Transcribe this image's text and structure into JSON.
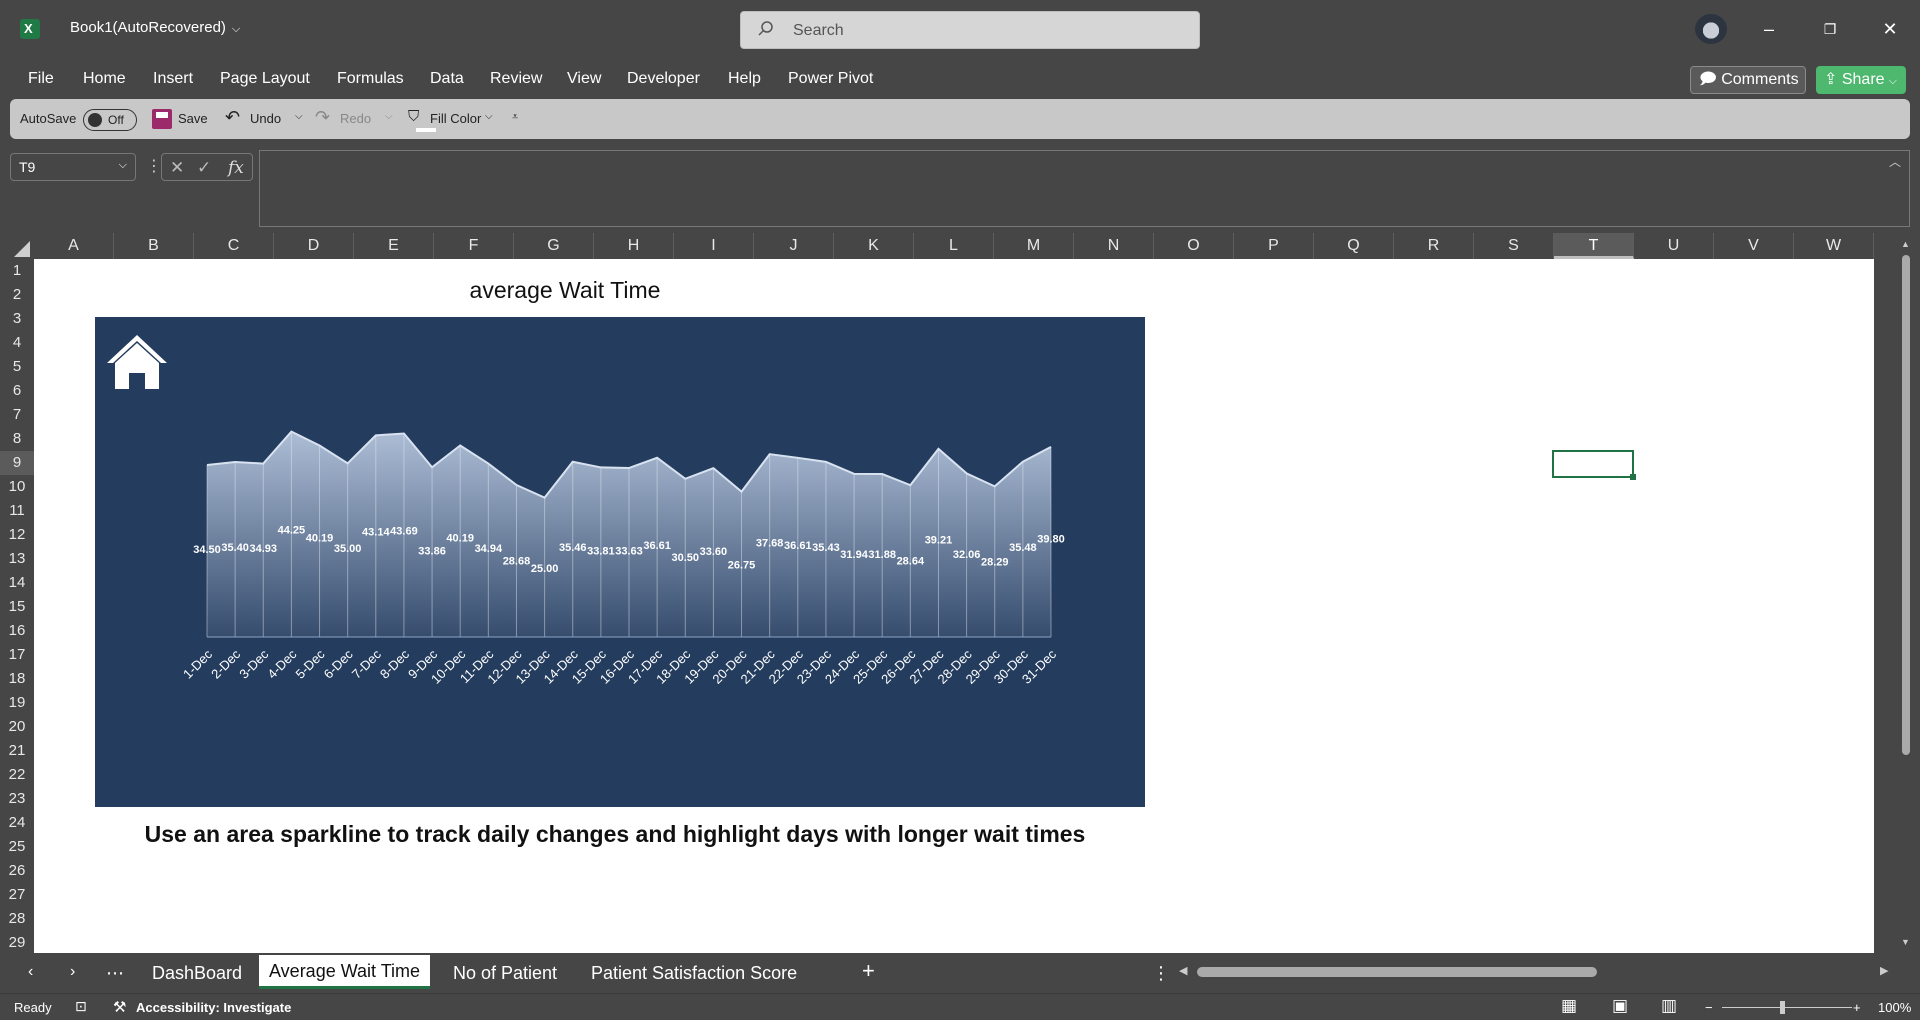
{
  "window": {
    "app_icon_letter": "X",
    "title": "Book1(AutoRecovered)",
    "search_placeholder": "Search"
  },
  "ribbon": {
    "tabs": [
      "File",
      "Home",
      "Insert",
      "Page Layout",
      "Formulas",
      "Data",
      "Review",
      "View",
      "Developer",
      "Help",
      "Power Pivot"
    ],
    "comments_label": "Comments",
    "share_label": "Share"
  },
  "qat": {
    "autosave_label": "AutoSave",
    "autosave_state": "Off",
    "save_label": "Save",
    "undo_label": "Undo",
    "redo_label": "Redo",
    "fill_color_label": "Fill Color"
  },
  "formula_bar": {
    "name_box": "T9",
    "fx_label": "fx"
  },
  "grid": {
    "columns": [
      "A",
      "B",
      "C",
      "D",
      "E",
      "F",
      "G",
      "H",
      "I",
      "J",
      "K",
      "L",
      "M",
      "N",
      "O",
      "P",
      "Q",
      "R",
      "S",
      "T",
      "U",
      "V",
      "W"
    ],
    "rows": [
      "1",
      "2",
      "3",
      "4",
      "5",
      "6",
      "7",
      "8",
      "9",
      "10",
      "11",
      "12",
      "13",
      "14",
      "15",
      "16",
      "17",
      "18",
      "19",
      "20",
      "21",
      "22",
      "23",
      "24",
      "25",
      "26",
      "27",
      "28",
      "29"
    ],
    "selected_column": "T",
    "selected_row": "9"
  },
  "sheet": {
    "title": "average Wait Time",
    "caption": "Use an area sparkline to track daily changes and highlight days with longer wait times"
  },
  "chart_data": {
    "type": "area",
    "title": "average Wait Time",
    "categories": [
      "1-Dec",
      "2-Dec",
      "3-Dec",
      "4-Dec",
      "5-Dec",
      "6-Dec",
      "7-Dec",
      "8-Dec",
      "9-Dec",
      "10-Dec",
      "11-Dec",
      "12-Dec",
      "13-Dec",
      "14-Dec",
      "15-Dec",
      "16-Dec",
      "17-Dec",
      "18-Dec",
      "19-Dec",
      "20-Dec",
      "21-Dec",
      "22-Dec",
      "23-Dec",
      "24-Dec",
      "25-Dec",
      "26-Dec",
      "27-Dec",
      "28-Dec",
      "29-Dec",
      "30-Dec",
      "31-Dec"
    ],
    "values": [
      34.5,
      35.4,
      34.93,
      44.25,
      40.19,
      35.0,
      43.14,
      43.69,
      33.86,
      40.19,
      34.94,
      28.68,
      25.0,
      35.46,
      33.81,
      33.63,
      36.61,
      30.5,
      33.6,
      26.75,
      37.68,
      36.61,
      35.43,
      31.94,
      31.88,
      28.64,
      39.21,
      32.06,
      28.29,
      35.48,
      39.8
    ],
    "labels": [
      "34.50",
      "35.40",
      "34.93",
      "44.25",
      "40.19",
      "35.00",
      "43.14",
      "43.69",
      "33.86",
      "40.19",
      "34.94",
      "28.68",
      "25.00",
      "35.46",
      "33.81",
      "33.63",
      "36.61",
      "30.50",
      "33.60",
      "26.75",
      "37.68",
      "36.61",
      "35.43",
      "31.94",
      "31.88",
      "28.64",
      "39.21",
      "32.06",
      "28.29",
      "35.48",
      "39.80"
    ],
    "colors": {
      "background": "#243c5e",
      "area_top": "#b4c4dc",
      "line": "#d8e2f0"
    }
  },
  "sheet_tabs": {
    "tabs": [
      "DashBoard",
      "Average Wait Time",
      "No of Patient",
      "Patient  Satisfaction Score"
    ],
    "active": "Average Wait Time",
    "add_label": "+"
  },
  "status_bar": {
    "ready": "Ready",
    "accessibility": "Accessibility: Investigate",
    "zoom": "100%"
  }
}
